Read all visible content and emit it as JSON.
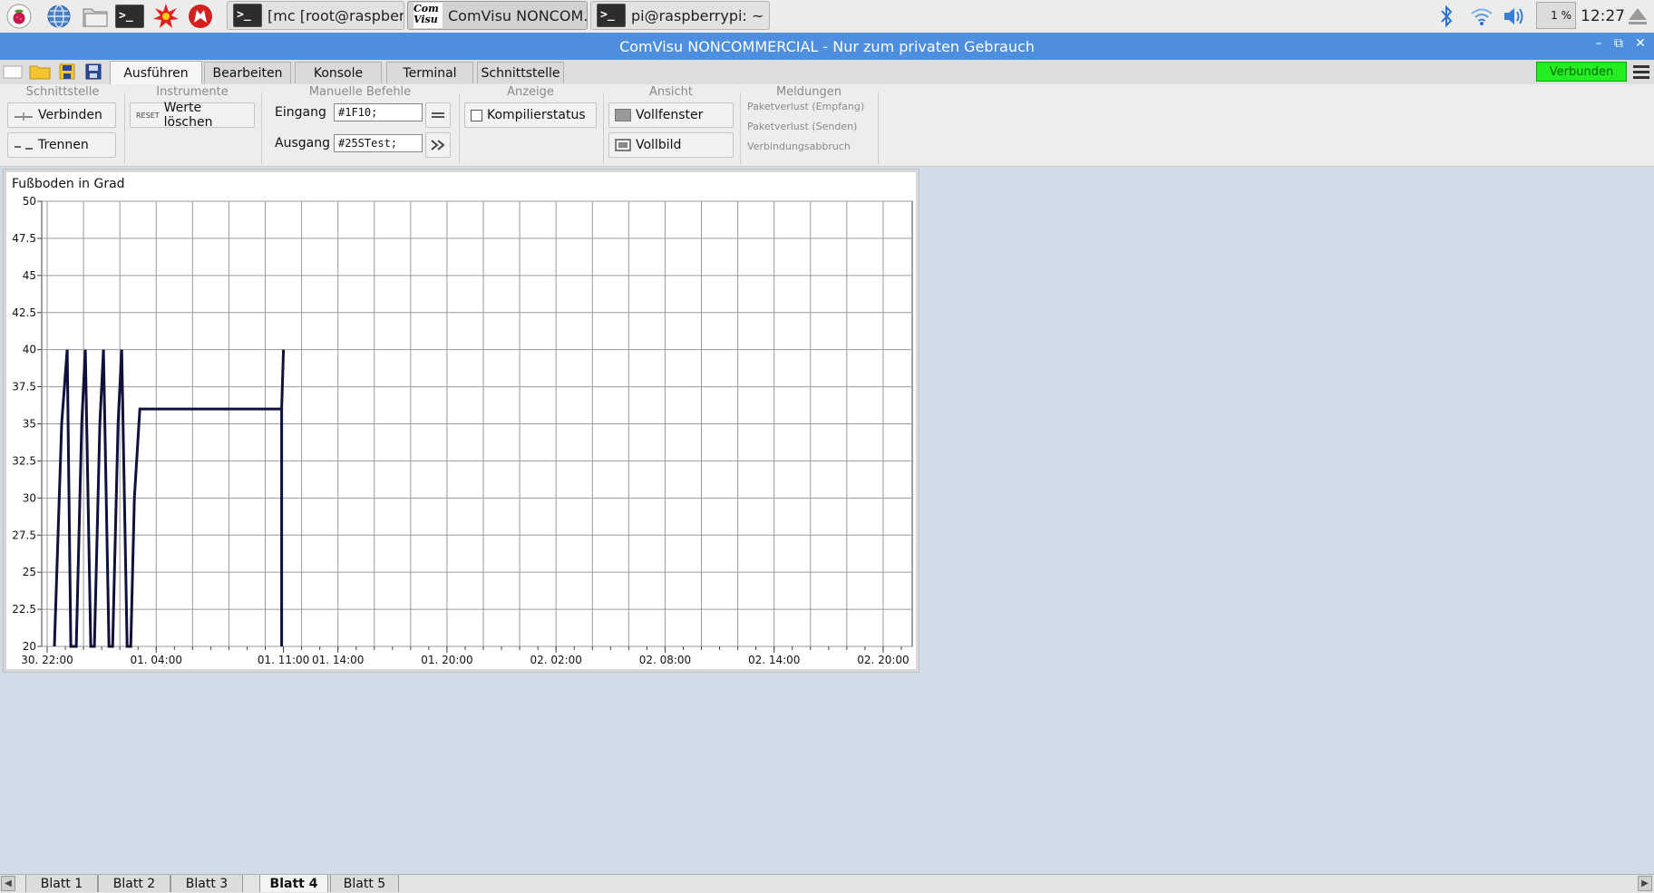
{
  "taskbar": {
    "launchers": [
      "raspberry-menu-icon",
      "web-browser-icon",
      "file-manager-icon",
      "terminal-icon",
      "math-kernel-icon",
      "wolfram-icon"
    ],
    "windows": [
      {
        "label": "[mc [root@raspberry...",
        "icon": "terminal-icon",
        "active": false
      },
      {
        "label": "ComVisu NONCOM...",
        "icon": "comvisu-icon",
        "active": true
      },
      {
        "label": "pi@raspberrypi: ~",
        "icon": "terminal-icon",
        "active": false
      }
    ],
    "comvisu_icon_text": [
      "Com",
      "Visu"
    ],
    "terminal_glyph": ">_",
    "cpu": "1 %",
    "clock": "12:27"
  },
  "window": {
    "title": "ComVisu NONCOMMERCIAL - Nur zum privaten Gebrauch",
    "controls": {
      "minimize": "–",
      "restore": "⧉",
      "close": "✕"
    }
  },
  "ribbon_tabs": [
    "Ausführen",
    "Bearbeiten",
    "Konsole",
    "Terminal",
    "Schnittstelle"
  ],
  "active_ribbon_tab": "Ausführen",
  "status": {
    "label": "Verbunden",
    "color": "#22ee22"
  },
  "ribbon": {
    "groups": {
      "schnittstelle": "Schnittstelle",
      "instrumente": "Instrumente",
      "manuelle": "Manuelle Befehle",
      "anzeige": "Anzeige",
      "ansicht": "Ansicht",
      "meldungen": "Meldungen"
    },
    "connect_label": "Verbinden",
    "disconnect_label": "Trennen",
    "reset_icon_text": "RESET",
    "clear_values_label": "Werte löschen",
    "input_label": "Eingang",
    "input_value": "#1F10;",
    "output_label": "Ausgang",
    "output_value": "#25STest;",
    "compile_status_label": "Kompilierstatus",
    "compile_status_checked": false,
    "fullwindow_label": "Vollfenster",
    "fullscreen_label": "Vollbild",
    "messages": [
      "Paketverlust (Empfang)",
      "Paketverlust (Senden)",
      "Verbindungsabbruch"
    ]
  },
  "chart_data": {
    "type": "line",
    "title": "Fußboden in Grad",
    "xlabel": "",
    "ylabel": "",
    "ylim": [
      20,
      50
    ],
    "yticks": [
      "20",
      "22.5",
      "25",
      "27.5",
      "30",
      "32.5",
      "35",
      "37.5",
      "40",
      "42.5",
      "45",
      "47.5",
      "50"
    ],
    "xlim_hours": [
      -2.3,
      45.6
    ],
    "xticks": [
      {
        "label": "30. 22:00",
        "hour": -2
      },
      {
        "label": "01. 04:00",
        "hour": 4
      },
      {
        "label": "01. 11:00",
        "hour": 11
      },
      {
        "label": "01. 14:00",
        "hour": 14
      },
      {
        "label": "01. 20:00",
        "hour": 20
      },
      {
        "label": "02. 02:00",
        "hour": 26
      },
      {
        "label": "02. 08:00",
        "hour": 32
      },
      {
        "label": "02. 14:00",
        "hour": 38
      },
      {
        "label": "02. 20:00",
        "hour": 44
      }
    ],
    "grid": true,
    "line_color": "#10103a",
    "series": [
      {
        "points": [
          [
            -1.6,
            20
          ],
          [
            -1.2,
            35
          ],
          [
            -0.9,
            40
          ],
          [
            -0.7,
            20
          ],
          [
            -0.4,
            20
          ],
          [
            -0.1,
            35
          ],
          [
            0.1,
            40
          ],
          [
            0.4,
            20
          ],
          [
            0.6,
            20
          ],
          [
            0.9,
            35
          ],
          [
            1.1,
            40
          ],
          [
            1.4,
            20
          ],
          [
            1.6,
            20
          ],
          [
            1.9,
            35
          ],
          [
            2.1,
            40
          ],
          [
            2.4,
            20
          ],
          [
            2.6,
            20
          ],
          [
            2.8,
            30
          ],
          [
            3.1,
            36
          ],
          [
            10.9,
            36
          ],
          [
            10.9,
            20
          ],
          [
            10.9,
            36
          ],
          [
            11.0,
            40
          ]
        ]
      }
    ]
  },
  "sheets": [
    "Blatt 1",
    "Blatt 2",
    "Blatt 3",
    "Blatt 4",
    "Blatt 5"
  ],
  "active_sheet": "Blatt 4"
}
